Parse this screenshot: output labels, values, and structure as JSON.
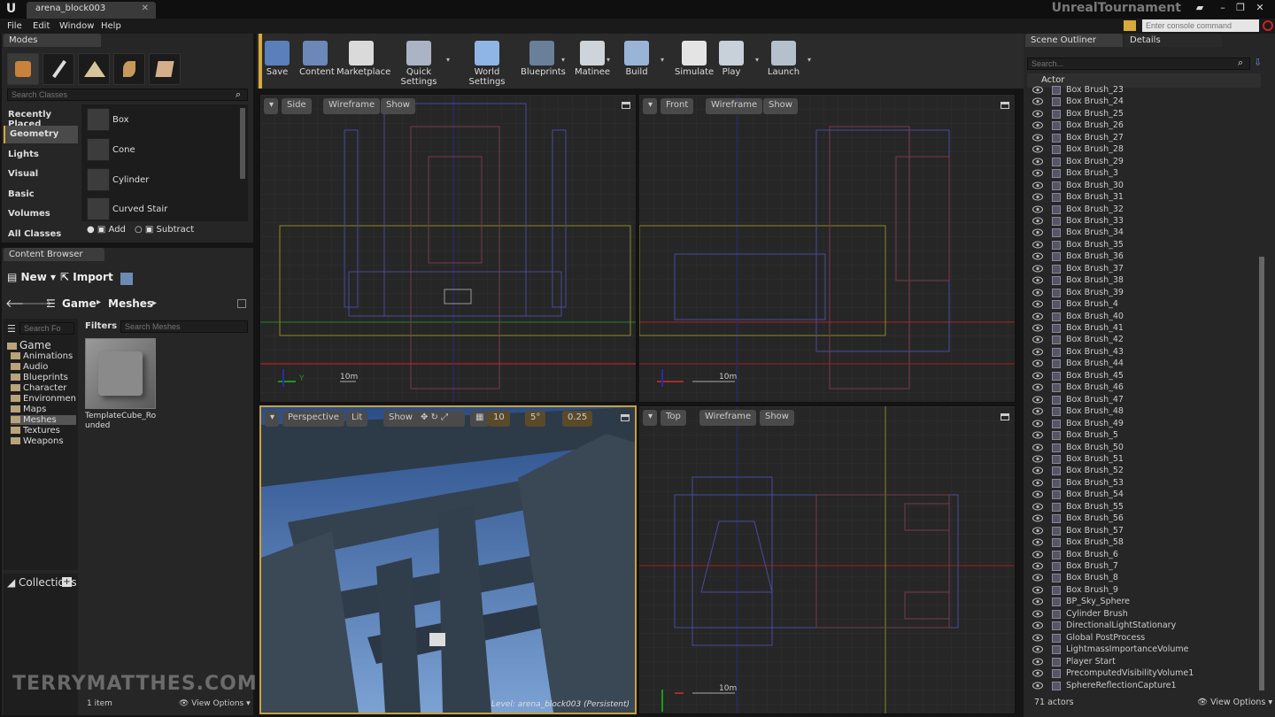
{
  "window": {
    "doc_tab": "arena_block003",
    "app_title": "UnrealTournament"
  },
  "menubar": [
    "File",
    "Edit",
    "Window",
    "Help"
  ],
  "console": {
    "placeholder": "Enter console command"
  },
  "modes": {
    "tab": "Modes",
    "search_placeholder": "Search Classes",
    "categories": [
      "Recently Placed",
      "Geometry",
      "Lights",
      "Visual",
      "Basic",
      "Volumes",
      "All Classes"
    ],
    "active_category": "Geometry",
    "items": [
      "Box",
      "Cone",
      "Cylinder",
      "Curved Stair"
    ],
    "add_label": "Add",
    "subtract_label": "Subtract"
  },
  "content_browser": {
    "tab": "Content Browser",
    "new_label": "New",
    "import_label": "Import",
    "path": [
      "Game",
      "Meshes"
    ],
    "search_folders_placeholder": "Search Fo",
    "filters_label": "Filters",
    "search_meshes_placeholder": "Search Meshes",
    "tree_root": "Game",
    "folders": [
      "Animations",
      "Audio",
      "Blueprints",
      "Character",
      "Environmen",
      "Maps",
      "Meshes",
      "Textures",
      "Weapons"
    ],
    "selected_folder": "Meshes",
    "asset_name": "TemplateCube_Rounded",
    "collections_label": "Collections",
    "item_count": "1 item",
    "view_options": "View Options"
  },
  "toolbar": [
    "Save",
    "Content",
    "Marketplace",
    "Quick Settings",
    "World Settings",
    "Blueprints",
    "Matinee",
    "Build",
    "Simulate",
    "Play",
    "Launch"
  ],
  "viewports": {
    "side": {
      "label": "Side",
      "mode": "Wireframe",
      "show": "Show",
      "scale": "10m"
    },
    "front": {
      "label": "Front",
      "mode": "Wireframe",
      "show": "Show",
      "scale": "10m"
    },
    "perspective": {
      "label": "Perspective",
      "mode": "Lit",
      "show": "Show",
      "grid_snap": "10",
      "rot_snap": "5°",
      "scale_snap": "0.25",
      "level_text": "Level:  arena_block003 (Persistent)"
    },
    "top": {
      "label": "Top",
      "mode": "Wireframe",
      "show": "Show",
      "scale": "10m"
    }
  },
  "watermark": "TERRYMATTHES.COM",
  "outliner": {
    "tab": "Scene Outliner",
    "details_tab": "Details",
    "search_placeholder": "Search...",
    "column": "Actor",
    "rows": [
      "Box Brush_23",
      "Box Brush_24",
      "Box Brush_25",
      "Box Brush_26",
      "Box Brush_27",
      "Box Brush_28",
      "Box Brush_29",
      "Box Brush_3",
      "Box Brush_30",
      "Box Brush_31",
      "Box Brush_32",
      "Box Brush_33",
      "Box Brush_34",
      "Box Brush_35",
      "Box Brush_36",
      "Box Brush_37",
      "Box Brush_38",
      "Box Brush_39",
      "Box Brush_4",
      "Box Brush_40",
      "Box Brush_41",
      "Box Brush_42",
      "Box Brush_43",
      "Box Brush_44",
      "Box Brush_45",
      "Box Brush_46",
      "Box Brush_47",
      "Box Brush_48",
      "Box Brush_49",
      "Box Brush_5",
      "Box Brush_50",
      "Box Brush_51",
      "Box Brush_52",
      "Box Brush_53",
      "Box Brush_54",
      "Box Brush_55",
      "Box Brush_56",
      "Box Brush_57",
      "Box Brush_58",
      "Box Brush_6",
      "Box Brush_7",
      "Box Brush_8",
      "Box Brush_9",
      "BP_Sky_Sphere",
      "Cylinder Brush",
      "DirectionalLightStationary",
      "Global PostProcess",
      "LightmassImportanceVolume",
      "Player Start",
      "PrecomputedVisibilityVolume1",
      "SphereReflectionCapture1"
    ],
    "actor_count": "71 actors",
    "view_options": "View Options"
  }
}
